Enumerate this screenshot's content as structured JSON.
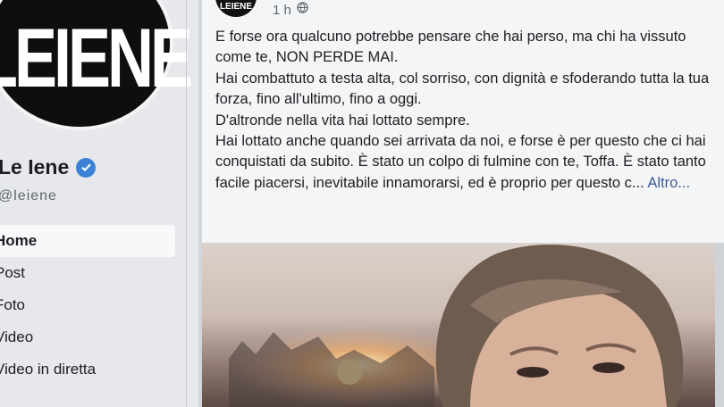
{
  "sidebar": {
    "logo_text": "LEIENE",
    "page_name": "Le Iene",
    "page_handle": "@leiene",
    "nav_items": [
      {
        "label": "Home",
        "active": true
      },
      {
        "label": "Post",
        "active": false
      },
      {
        "label": "Foto",
        "active": false
      },
      {
        "label": "Video",
        "active": false
      },
      {
        "label": "Video in diretta",
        "active": false
      }
    ]
  },
  "post": {
    "avatar_text": "LEIENE",
    "time": "1 h",
    "privacy_icon": "globe-icon",
    "paragraphs": [
      "E forse ora qualcuno potrebbe pensare che hai perso, ma chi ha vissuto come te, NON PERDE MAI.",
      "Hai combattuto a testa alta, col sorriso, con dignità e sfoderando tutta la tua forza, fino all'ultimo, fino a oggi.",
      "D'altronde nella vita hai lottato sempre.",
      "Hai lottato anche quando sei arrivata da noi, e forse è per questo che ci hai conquistati da subito. È stato un colpo di fulmine con te, Toffa. È stato tanto facile piacersi, inevitabile innamorarsi, ed è proprio per questo c..."
    ],
    "more_label": "Altro..."
  },
  "colors": {
    "verified": "#3b82d6",
    "link": "#3b5998"
  }
}
